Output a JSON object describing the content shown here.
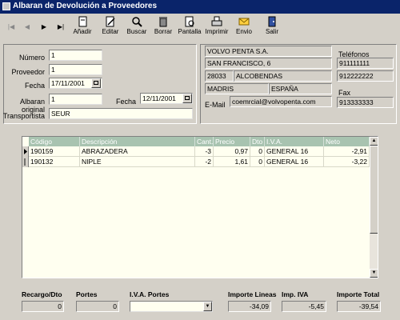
{
  "window": {
    "title": "Albaran de Devolución a Proveedores"
  },
  "nav": {
    "first": "|◀",
    "prev": "◀",
    "next": "▶",
    "last": "▶|"
  },
  "toolbar": {
    "add": "Añadir",
    "edit": "Editar",
    "search": "Buscar",
    "delete": "Borrar",
    "screen": "Pantalla",
    "print": "Imprimir",
    "send": "Envio",
    "exit": "Salir"
  },
  "form": {
    "numero_label": "Número",
    "numero": "1",
    "proveedor_label": "Proveedor",
    "proveedor": "1",
    "fecha_label": "Fecha",
    "fecha": "17/11/2001",
    "albaran_label": "Albaran original",
    "albaran": "1",
    "fecha2_label": "Fecha",
    "fecha2": "12/11/2001",
    "transportista_label": "Transportista",
    "transportista": "SEUR"
  },
  "supplier": {
    "name": "VOLVO PENTA S.A.",
    "address": "SAN FRANCISCO, 6",
    "postal": "28033",
    "city": "ALCOBENDAS",
    "province": "MADRIS",
    "country": "ESPAÑA",
    "email_label": "E-Mail",
    "email": "coemrcial@volvopenta.com",
    "phones_label": "Teléfonos",
    "phone1": "911111111",
    "phone2": "912222222",
    "fax_label": "Fax",
    "fax": "913333333"
  },
  "grid": {
    "headers": [
      "Código",
      "Descripción",
      "Cant.",
      "Precio",
      "Dto",
      "I.V.A.",
      "Neto"
    ],
    "rows": [
      {
        "codigo": "190159",
        "descripcion": "ABRAZADERA",
        "cant": "-3",
        "precio": "0,97",
        "dto": "0",
        "iva": "GENERAL 16",
        "neto": "-2,91"
      },
      {
        "codigo": "190132",
        "descripcion": "NIPLE",
        "cant": "-2",
        "precio": "1,61",
        "dto": "0",
        "iva": "GENERAL 16",
        "neto": "-3,22"
      }
    ]
  },
  "totals": {
    "recargo_label": "Recargo/Dto",
    "recargo": "0",
    "portes_label": "Portes",
    "portes": "0",
    "iva_portes_label": "I.V.A. Portes",
    "iva_portes": "",
    "importe_lineas_label": "Importe Lineas",
    "importe_lineas": "-34,09",
    "imp_iva_label": "Imp. IVA",
    "imp_iva": "-5,45",
    "importe_total_label": "Importe Total",
    "importe_total": "-39,54"
  }
}
